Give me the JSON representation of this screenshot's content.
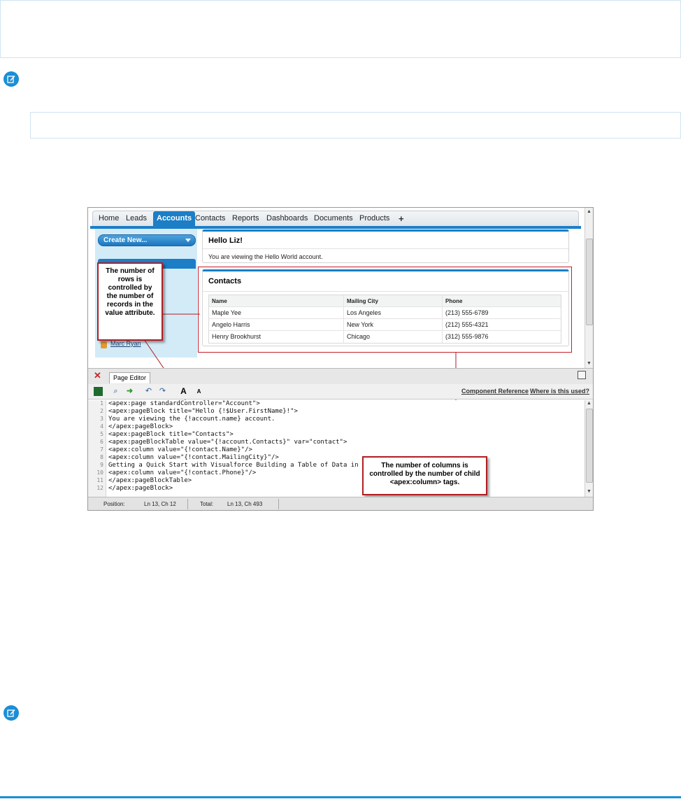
{
  "nav": {
    "tabs": [
      "Home",
      "Leads",
      "Accounts",
      "Contacts",
      "Reports",
      "Dashboards",
      "Documents",
      "Products"
    ],
    "active_tab": "Accounts",
    "plus": "+"
  },
  "sidebar": {
    "create_new": "Create New...",
    "recent_item": "Marc Ryan"
  },
  "hello_block": {
    "title": "Hello Liz!",
    "text": "You are viewing the Hello World account."
  },
  "contacts_block": {
    "title": "Contacts",
    "columns": [
      "Name",
      "Mailing City",
      "Phone"
    ],
    "rows": [
      [
        "Maple Yee",
        "Los Angeles",
        "(213) 555-6789"
      ],
      [
        "Angelo Harris",
        "New York",
        "(212) 555-4321"
      ],
      [
        "Henry Brookhurst",
        "Chicago",
        "(312) 555-9876"
      ]
    ]
  },
  "callouts": {
    "rows": "The number of rows is controlled by the number of records in the value attribute.",
    "columns": "The number of columns is controlled by the number of child <apex:column> tags."
  },
  "editor": {
    "tab_label": "Page Editor",
    "component_reference": "Component Reference",
    "where_used": "Where is this used?",
    "bold_a": "A",
    "small_a": "A",
    "code_lines": [
      "<apex:page standardController=\"Account\">",
      "<apex:pageBlock title=\"Hello {!$User.FirstName}!\">",
      "You are viewing the {!account.name} account.",
      "</apex:pageBlock>",
      "<apex:pageBlock title=\"Contacts\">",
      "<apex:pageBlockTable value=\"{!account.Contacts}\" var=\"contact\">",
      "<apex:column value=\"{!contact.Name}\"/>",
      "<apex:column value=\"{!contact.MailingCity}\"/>",
      "Getting a Quick Start with Visualforce Building a Table of Data in a Page",
      "<apex:column value=\"{!contact.Phone}\"/>",
      "</apex:pageBlockTable>",
      "</apex:pageBlock>"
    ],
    "line_numbers": [
      "1",
      "2",
      "3",
      "4",
      "5",
      "6",
      "7",
      "8",
      "9",
      "10",
      "11",
      "12"
    ]
  },
  "status": {
    "position_label": "Position:",
    "position_value": "Ln 13, Ch 12",
    "total_label": "Total:",
    "total_value": "Ln 13, Ch 493"
  },
  "colors": {
    "accent": "#1b7ec6",
    "callout_border": "#b01e23",
    "sidebar_bg": "#d3ebf7"
  },
  "icons": [
    "note-icon",
    "save-icon",
    "find-icon",
    "goto-icon",
    "undo-icon",
    "redo-icon",
    "close-icon",
    "download-icon"
  ]
}
